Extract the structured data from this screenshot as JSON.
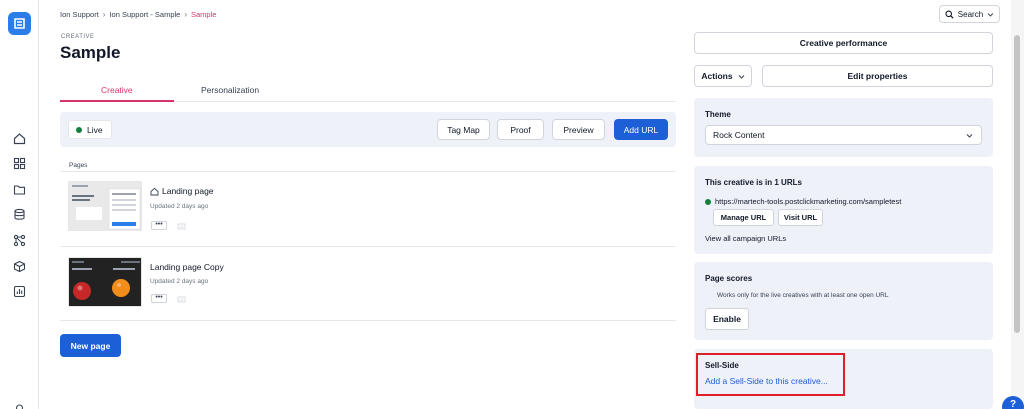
{
  "breadcrumb": {
    "items": [
      "Ion Support",
      "Ion Support - Sample",
      "Sample"
    ]
  },
  "search": {
    "label": "Search"
  },
  "header": {
    "kind": "CREATIVE",
    "title": "Sample"
  },
  "tabs": [
    {
      "label": "Creative",
      "active": true
    },
    {
      "label": "Personalization",
      "active": false
    }
  ],
  "toolbar": {
    "status": "Live",
    "tag_map": "Tag Map",
    "proof": "Proof",
    "preview": "Preview",
    "add_url": "Add URL"
  },
  "pages": {
    "label": "Pages",
    "items": [
      {
        "name": "Landing page",
        "updated": "Updated 2 days ago",
        "home": true
      },
      {
        "name": "Landing page Copy",
        "updated": "Updated 2 days ago",
        "home": false
      }
    ],
    "more": "•••",
    "new_page": "New page"
  },
  "right": {
    "creative_performance": "Creative performance",
    "actions": "Actions",
    "edit_properties": "Edit properties",
    "theme": {
      "title": "Theme",
      "value": "Rock Content"
    },
    "urls": {
      "title": "This creative is in 1 URLs",
      "url": "https://martech-tools.postclickmarketing.com/sampletest",
      "manage": "Manage URL",
      "visit": "Visit URL",
      "view_all": "View all campaign URLs"
    },
    "scores": {
      "title": "Page scores",
      "note": "Works only for the live creatives with at least one open URL",
      "enable": "Enable"
    },
    "sell_side": {
      "title": "Sell-Side",
      "link": "Add a Sell-Side to this creative..."
    }
  },
  "help": {
    "label": "?"
  },
  "colors": {
    "accent": "#d6336c",
    "primary": "#1d5fd6",
    "panel": "#eef1f8",
    "live": "#15803d",
    "highlight": "#e11d2a"
  }
}
